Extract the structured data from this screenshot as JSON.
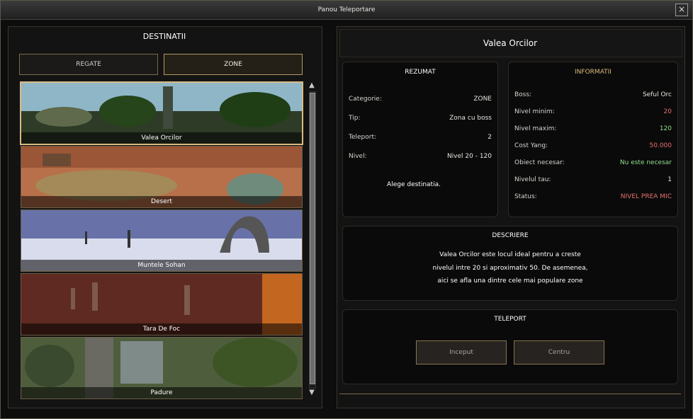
{
  "window": {
    "title": "Panou Teleportare"
  },
  "left": {
    "heading": "DESTINATII",
    "tabs": [
      {
        "label": "REGATE"
      },
      {
        "label": "ZONE"
      }
    ],
    "destinations": [
      {
        "name": "Valea Orcilor"
      },
      {
        "name": "Desert"
      },
      {
        "name": "Muntele Sohan"
      },
      {
        "name": "Tara De Foc"
      },
      {
        "name": "Padure"
      }
    ]
  },
  "right": {
    "title": "Valea Orcilor",
    "summary": {
      "heading": "REZUMAT",
      "rows": [
        {
          "k": "Categorie:",
          "v": "ZONE"
        },
        {
          "k": "Tip:",
          "v": "Zona cu boss"
        },
        {
          "k": "Teleport:",
          "v": "2"
        },
        {
          "k": "Nivel:",
          "v": "Nivel 20 - 120"
        }
      ],
      "hint": "Alege destinatia."
    },
    "info": {
      "heading": "INFORMATII",
      "rows": [
        {
          "k": "Boss:",
          "v": "Seful Orc"
        },
        {
          "k": "Nivel minim:",
          "v": "20"
        },
        {
          "k": "Nivel maxim:",
          "v": "120"
        },
        {
          "k": "Cost Yang:",
          "v": "50.000"
        },
        {
          "k": "Obiect necesar:",
          "v": "Nu este necesar"
        },
        {
          "k": "Nivelul tau:",
          "v": "1"
        },
        {
          "k": "Status:",
          "v": "NIVEL PREA MIC"
        }
      ]
    },
    "description": {
      "heading": "DESCRIERE",
      "lines": [
        "Valea Orcilor este locul ideal pentru a creste",
        "nivelul intre 20 si aproximativ 50. De asemenea,",
        "aici se afla una dintre cele mai populare zone"
      ]
    },
    "teleport": {
      "heading": "TELEPORT",
      "buttons": [
        {
          "label": "Inceput"
        },
        {
          "label": "Centru"
        }
      ]
    }
  },
  "colors": {
    "red": "#e86f6f",
    "green": "#8fe08f",
    "gold": "#d9bb7f"
  },
  "icons": {
    "close": "close-icon",
    "scroll_up": "arrow-up-icon",
    "scroll_down": "arrow-down-icon"
  }
}
